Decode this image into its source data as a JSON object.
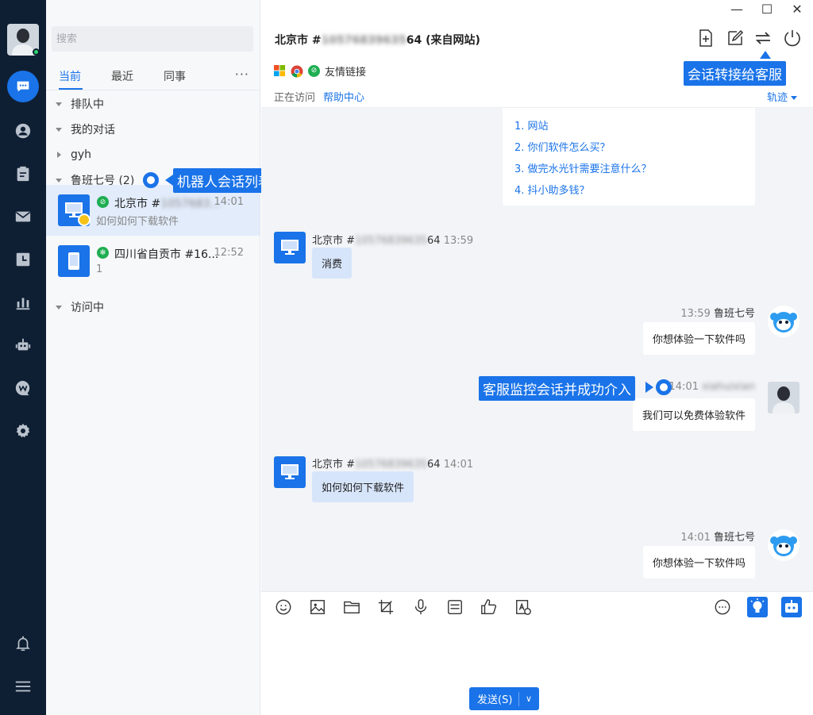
{
  "colors": {
    "accent": "#1a73e8",
    "rail": "#0f1f33",
    "online": "#2bd46b"
  },
  "rail": {
    "nav": [
      "chat-icon",
      "user-icon",
      "clipboard-icon",
      "mail-icon",
      "clock-icon",
      "chart-icon",
      "robot-icon",
      "w-chat-icon",
      "settings-icon"
    ],
    "bottom": [
      "bell-icon",
      "menu-icon"
    ]
  },
  "sidebar": {
    "search_placeholder": "搜索",
    "tabs": [
      "当前",
      "最近",
      "同事"
    ],
    "more": "···",
    "groups": {
      "queue": "排队中",
      "mine": "我的对话",
      "gyh": "gyh",
      "robot": "鲁班七号 (2)",
      "visiting": "访问中"
    },
    "items": [
      {
        "name_prefix": "北京市 #",
        "name_blur": "1057683...",
        "time": "14:01",
        "preview": "如何如何下载软件"
      },
      {
        "name": "四川省自贡市 #16...",
        "time": "12:52",
        "preview": "1"
      }
    ]
  },
  "annotations": {
    "robot_list": "机器人会话列表",
    "transfer": "会话转接给客服",
    "monitor": "客服监控会话并成功介入"
  },
  "window": {
    "minimize": "—",
    "maximize": "☐",
    "close": "✕"
  },
  "header": {
    "title_prefix": "北京市 #",
    "title_blur": "10576839635",
    "title_suffix": "64 (来自网站)",
    "source": "友情链接",
    "visiting_label": "正在访问",
    "visiting_page": "帮助中心",
    "track": "轨迹"
  },
  "faq": [
    "1. 网站",
    "2. 你们软件怎么买？",
    "3. 做完水光针需要注意什么？",
    "4. 抖小助多钱？"
  ],
  "messages": [
    {
      "who_prefix": "北京市 #",
      "who_blur": "10576839635",
      "who_suffix": "64",
      "time": "13:59",
      "text": "消费"
    },
    {
      "who": "鲁班七号",
      "time": "13:59",
      "text": "你想体验一下软件吗"
    },
    {
      "who_blur": "xiahuixian",
      "time": "14:01",
      "text": "我们可以免费体验软件"
    },
    {
      "who_prefix": "北京市 #",
      "who_blur": "10576839635",
      "who_suffix": "64",
      "time": "14:01",
      "text": "如何如何下载软件"
    },
    {
      "who": "鲁班七号",
      "time": "14:01",
      "text": "你想体验一下软件吗"
    }
  ],
  "composer": {
    "tools": [
      "emoji-icon",
      "image-icon",
      "folder-icon",
      "crop-icon",
      "mic-icon",
      "quick-reply-icon",
      "thumbs-up-icon",
      "translate-icon"
    ],
    "send": "发送(S)"
  }
}
